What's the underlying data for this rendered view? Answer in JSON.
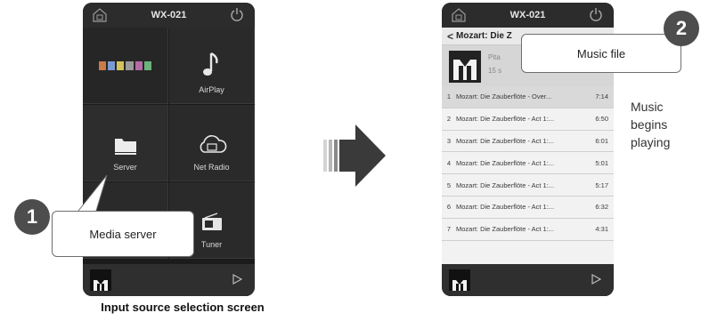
{
  "screen1": {
    "title": "WX-021",
    "tiles": {
      "airplay": "AirPlay",
      "server": "Server",
      "net_radio": "Net Radio",
      "tuner": "Tuner"
    },
    "callout": {
      "number": "1",
      "text": "Media server"
    },
    "caption": "Input source selection screen"
  },
  "screen2": {
    "title": "WX-021",
    "nav_title": "Mozart: Die Z",
    "album_lines": [
      "Pita",
      "15 s"
    ],
    "tracks": [
      {
        "n": "1",
        "title": "Mozart: Die Zauberflöte - Over...",
        "dur": "7:14"
      },
      {
        "n": "2",
        "title": "Mozart: Die Zauberflöte - Act 1:...",
        "dur": "6:50"
      },
      {
        "n": "3",
        "title": "Mozart: Die Zauberflöte - Act 1:...",
        "dur": "6:01"
      },
      {
        "n": "4",
        "title": "Mozart: Die Zauberflöte - Act 1:...",
        "dur": "5:01"
      },
      {
        "n": "5",
        "title": "Mozart: Die Zauberflöte - Act 1:...",
        "dur": "5:17"
      },
      {
        "n": "6",
        "title": "Mozart: Die Zauberflöte - Act 1:...",
        "dur": "6:32"
      },
      {
        "n": "7",
        "title": "Mozart: Die Zauberflöte - Act 1:...",
        "dur": "4:31"
      }
    ],
    "callout": {
      "number": "2",
      "text": "Music file"
    },
    "side_text": [
      "Music",
      "begins",
      "playing"
    ]
  },
  "colors": {
    "phone_bg": "#1b1b1b",
    "callout": "#4d4d4d"
  }
}
